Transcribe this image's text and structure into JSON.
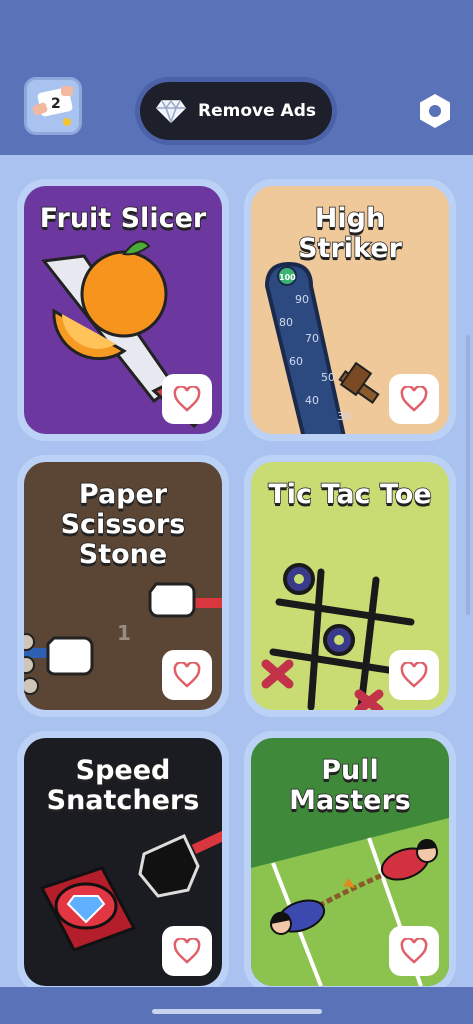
{
  "header": {
    "app_icon_badge": "2",
    "remove_ads_label": "Remove Ads"
  },
  "games": [
    {
      "title": "Fruit Slicer",
      "bg": "#6c38a0"
    },
    {
      "title": "High\nStriker",
      "bg": "#f0c99a"
    },
    {
      "title": "Paper\nScissors\nStone",
      "bg": "#5b4534"
    },
    {
      "title": "Tic Tac Toe",
      "bg": "#c9dc74"
    },
    {
      "title": "Speed\nSnatchers",
      "bg": "#1b1b22"
    },
    {
      "title": "Pull\nMasters",
      "bg": "#3f8a3a"
    }
  ],
  "art_text": {
    "striker_100": "100",
    "striker_90": "90",
    "striker_80": "80",
    "striker_70": "70",
    "striker_60": "60",
    "striker_50": "50",
    "striker_40": "40",
    "striker_30": "30",
    "pss_score": "1"
  },
  "colors": {
    "header_bg": "#5a72b8",
    "content_bg": "#a9c2f0",
    "heart": "#e0606a"
  },
  "icons": {
    "diamond": "diamond-icon",
    "settings": "hexagon-settings-icon",
    "favorite": "heart-outline-icon"
  }
}
